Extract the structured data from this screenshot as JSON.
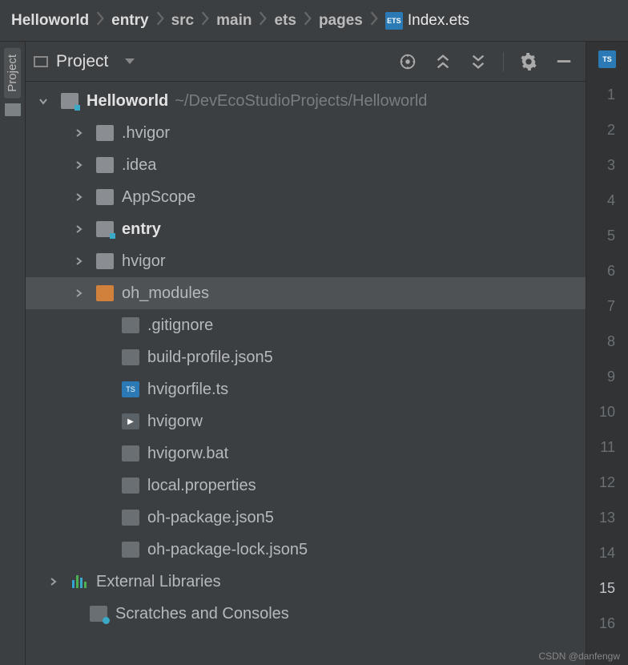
{
  "breadcrumb": {
    "items": [
      {
        "label": "Helloworld",
        "active": true
      },
      {
        "label": "entry",
        "active": true
      },
      {
        "label": "src",
        "active": false
      },
      {
        "label": "main",
        "active": false
      },
      {
        "label": "ets",
        "active": false
      },
      {
        "label": "pages",
        "active": false
      }
    ],
    "file": {
      "name": "Index.ets",
      "badge": "ETS"
    }
  },
  "sidebar": {
    "tab_label": "Project"
  },
  "panel": {
    "title": "Project"
  },
  "tool_icons": {
    "target": "target-icon",
    "expand": "expand-icon",
    "collapse": "collapse-icon",
    "settings": "gear-icon",
    "hide": "minimize-icon"
  },
  "tree": {
    "root": {
      "name": "Helloworld",
      "path": "~/DevEcoStudioProjects/Helloworld"
    },
    "items": [
      {
        "name": ".hvigor",
        "type": "folder-g",
        "depth": 1,
        "arrow": "r"
      },
      {
        "name": ".idea",
        "type": "folder-g",
        "depth": 1,
        "arrow": "r"
      },
      {
        "name": "AppScope",
        "type": "folder-g",
        "depth": 1,
        "arrow": "r"
      },
      {
        "name": "entry",
        "type": "folder-m",
        "depth": 1,
        "arrow": "r",
        "bold": true
      },
      {
        "name": "hvigor",
        "type": "folder-g",
        "depth": 1,
        "arrow": "r"
      },
      {
        "name": "oh_modules",
        "type": "folder-o",
        "depth": 1,
        "arrow": "r",
        "sel": true
      },
      {
        "name": ".gitignore",
        "type": "file",
        "depth": 2
      },
      {
        "name": "build-profile.json5",
        "type": "file",
        "depth": 2
      },
      {
        "name": "hvigorfile.ts",
        "type": "ts",
        "depth": 2
      },
      {
        "name": "hvigorw",
        "type": "sh",
        "depth": 2
      },
      {
        "name": "hvigorw.bat",
        "type": "file",
        "depth": 2
      },
      {
        "name": "local.properties",
        "type": "file",
        "depth": 2
      },
      {
        "name": "oh-package.json5",
        "type": "file",
        "depth": 2
      },
      {
        "name": "oh-package-lock.json5",
        "type": "file",
        "depth": 2
      }
    ],
    "ext_lib": "External Libraries",
    "scratches": "Scratches and Consoles"
  },
  "gutter": {
    "file_badge": "TS",
    "lines": [
      1,
      2,
      3,
      4,
      5,
      6,
      7,
      8,
      9,
      10,
      11,
      12,
      13,
      14,
      15,
      16
    ],
    "highlight": 15
  },
  "watermark": "CSDN @danfengw"
}
